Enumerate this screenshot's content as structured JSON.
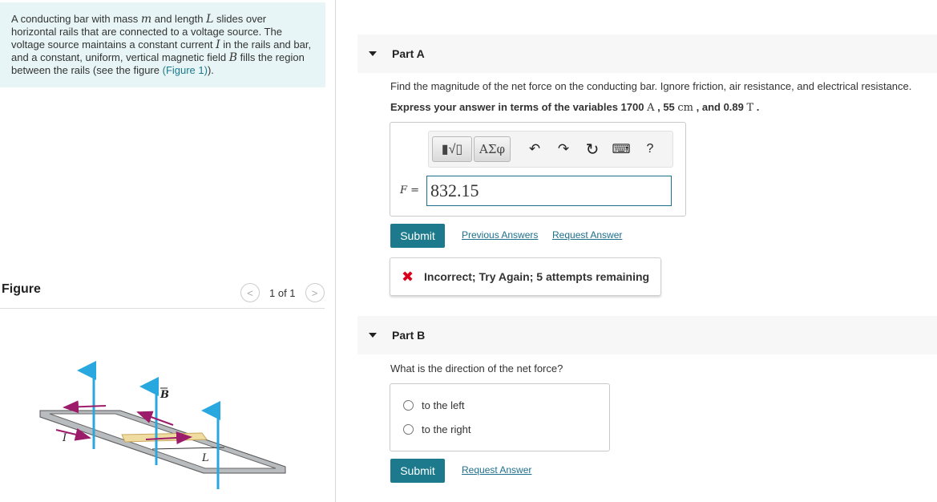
{
  "problem": {
    "t1": "A conducting bar with mass ",
    "m": "m",
    "t2": " and length ",
    "L": "L",
    "t3": " slides over horizontal rails that are connected to a voltage source. The voltage source maintains a constant current ",
    "I": "I",
    "t4": " in the rails and bar, and a constant, uniform, vertical magnetic field ",
    "B": "B",
    "t5": " fills the region between the rails (see the figure ",
    "figure_link": "(Figure 1)",
    "t6": ")."
  },
  "figure": {
    "title": "Figure",
    "counter": "1 of 1",
    "prev_glyph": "<",
    "next_glyph": ">",
    "labels": {
      "B": "B",
      "I": "I",
      "L": "L"
    }
  },
  "partA": {
    "label": "Part A",
    "question": "Find the magnitude of the net force on the conducting bar. Ignore friction, air resistance, and electrical resistance.",
    "express_prefix": "Express your answer in terms of the variables 1700 ",
    "unit_A": "A",
    "sep1": " , 55 ",
    "unit_cm": "cm",
    "sep2": " , and 0.89 ",
    "unit_T": "T",
    "sep3": " .",
    "toolbar": {
      "templates_glyph": "▮√▯",
      "symbols_label": "ΑΣφ",
      "undo_glyph": "↶",
      "redo_glyph": "↷",
      "reset_glyph": "↻",
      "keyboard_glyph": "⌨",
      "help_glyph": "?"
    },
    "var_name": "F",
    "var_eq": " =",
    "answer_value": "832.15",
    "submit_label": "Submit",
    "previous_answers_label": "Previous Answers",
    "request_answer_label": "Request Answer",
    "feedback_icon": "✖",
    "feedback_text": "Incorrect; Try Again; 5 attempts remaining"
  },
  "partB": {
    "label": "Part B",
    "question": "What is the direction of the net force?",
    "options": [
      "to the left",
      "to the right"
    ],
    "submit_label": "Submit",
    "request_answer_label": "Request Answer"
  },
  "colors": {
    "accent": "#1d7a8c",
    "problem_bg": "#e8f5f6",
    "error": "#d9001b",
    "field_arrow": "#29a8e0",
    "force_arrow": "#9c1c6b"
  }
}
